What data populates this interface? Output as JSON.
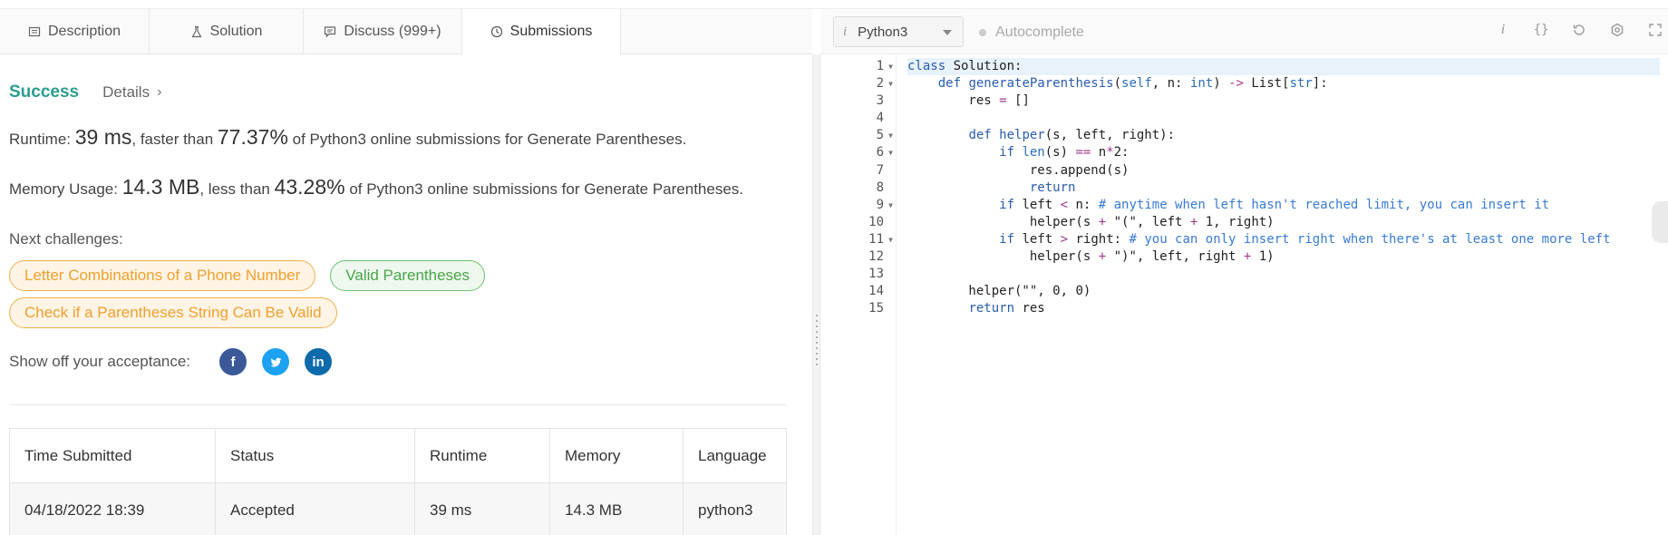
{
  "tabs": [
    {
      "label": "Description",
      "icon": "document-icon"
    },
    {
      "label": "Solution",
      "icon": "flask-icon"
    },
    {
      "label": "Discuss (999+)",
      "icon": "chat-icon"
    },
    {
      "label": "Submissions",
      "icon": "clock-icon",
      "active": true
    }
  ],
  "result": {
    "status": "Success",
    "details_label": "Details",
    "runtime_prefix": "Runtime: ",
    "runtime_value": "39 ms",
    "runtime_mid": ", faster than ",
    "runtime_pct": "77.37%",
    "runtime_suffix": " of Python3 online submissions for Generate Parentheses.",
    "memory_prefix": "Memory Usage: ",
    "memory_value": "14.3 MB",
    "memory_mid": ", less than ",
    "memory_pct": "43.28%",
    "memory_suffix": " of Python3 online submissions for Generate Parentheses."
  },
  "next_challenges": {
    "label": "Next challenges:",
    "items": [
      {
        "label": "Letter Combinations of a Phone Number",
        "difficulty": "medium"
      },
      {
        "label": "Valid Parentheses",
        "difficulty": "easy"
      },
      {
        "label": "Check if a Parentheses String Can Be Valid",
        "difficulty": "medium"
      }
    ]
  },
  "share": {
    "label": "Show off your acceptance:",
    "icons": [
      "facebook-icon",
      "twitter-icon",
      "linkedin-icon"
    ]
  },
  "table": {
    "headers": [
      "Time Submitted",
      "Status",
      "Runtime",
      "Memory",
      "Language"
    ],
    "rows": [
      [
        "04/18/2022 18:39",
        "Accepted",
        "39 ms",
        "14.3 MB",
        "python3"
      ]
    ]
  },
  "editor": {
    "language": "Python3",
    "autocomplete_label": "Autocomplete",
    "toolbar_icons": [
      "info-icon",
      "braces-icon",
      "reset-icon",
      "settings-icon",
      "fullscreen-icon"
    ],
    "line_numbers": [
      "1",
      "2",
      "3",
      "4",
      "5",
      "6",
      "7",
      "8",
      "9",
      "10",
      "11",
      "12",
      "13",
      "14",
      "15"
    ],
    "fold_lines": [
      1,
      2,
      5,
      6,
      9,
      11
    ]
  },
  "colors": {
    "accent": "#2b9e8f",
    "medium": "#f0a030",
    "easy": "#4aa64a"
  }
}
